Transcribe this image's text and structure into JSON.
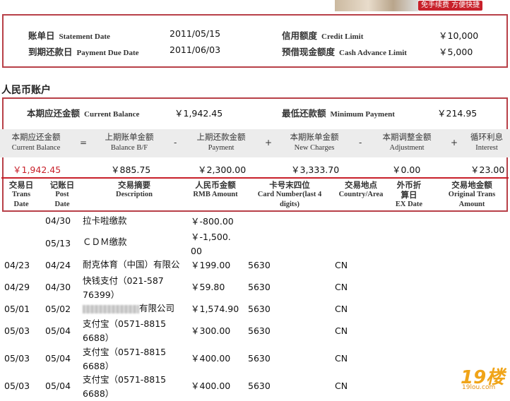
{
  "banner": {
    "text": "免手续费 方便快捷"
  },
  "statement": {
    "statement_date_cn": "账单日",
    "statement_date_en": "Statement Date",
    "statement_date": "2011/05/15",
    "credit_limit_cn": "信用额度",
    "credit_limit_en": "Credit Limit",
    "credit_limit": "￥10,000",
    "due_date_cn": "到期还款日",
    "due_date_en": "Payment Due Date",
    "due_date": "2011/06/03",
    "cash_limit_cn": "预借现金额度",
    "cash_limit_en": "Cash Advance Limit",
    "cash_limit": "￥5,000"
  },
  "rmb": {
    "title": "人民币账户",
    "current_balance_cn": "本期应还金额",
    "current_balance_en": "Current Balance",
    "current_balance": "￥1,942.45",
    "min_payment_cn": "最低还款额",
    "min_payment_en": "Minimum Payment",
    "min_payment": "￥214.95",
    "calc": [
      {
        "cn": "本期应还金额",
        "en": "Current Balance"
      },
      {
        "cn": "上期账单金额",
        "en": "Balance B/F"
      },
      {
        "cn": "上期还款金额",
        "en": "Payment"
      },
      {
        "cn": "本期账单金额",
        "en": "New Charges"
      },
      {
        "cn": "本期调整金额",
        "en": "Adjustment"
      },
      {
        "cn": "循环利息",
        "en": "Interest"
      }
    ],
    "ops": [
      "=",
      "-",
      "+",
      "-",
      "+"
    ],
    "amounts": [
      "￥1,942.45",
      "￥885.75",
      "￥2,300.00",
      "￥3,333.70",
      "￥0.00",
      "￥23.00"
    ]
  },
  "table": {
    "headers": [
      {
        "cn": "交易日",
        "en": "Trans Date"
      },
      {
        "cn": "记账日",
        "en": "Post Date"
      },
      {
        "cn": "交易摘要",
        "en": "Description"
      },
      {
        "cn": "人民币金额",
        "en": "RMB Amount"
      },
      {
        "cn": "卡号末四位",
        "en": "Card Number(last 4 digits)"
      },
      {
        "cn": "交易地点",
        "en": "Country/Area"
      },
      {
        "cn": "外币折算日",
        "en": "EX Date"
      },
      {
        "cn": "交易地金额",
        "en": "Original Trans Amount"
      }
    ],
    "rows": [
      {
        "trans": "",
        "post": "04/30",
        "desc": "拉卡啦缴款",
        "amount": "￥-800.00",
        "card": "",
        "country": ""
      },
      {
        "trans": "",
        "post": "05/13",
        "desc": "ＣＤＭ缴款",
        "amount": "￥-1,500.00",
        "card": "",
        "country": ""
      },
      {
        "trans": "04/23",
        "post": "04/24",
        "desc": "耐克体育（中国）有限公",
        "amount": "￥199.00",
        "card": "5630",
        "country": "CN"
      },
      {
        "trans": "04/29",
        "post": "04/30",
        "desc": "快钱支付（021-58776399）",
        "amount": "￥59.80",
        "card": "5630",
        "country": "CN"
      },
      {
        "trans": "05/01",
        "post": "05/02",
        "desc": "有限公司",
        "amount": "￥1,574.90",
        "card": "5630",
        "country": "CN"
      },
      {
        "trans": "05/03",
        "post": "05/04",
        "desc": "支付宝（0571-88156688）",
        "amount": "￥300.00",
        "card": "5630",
        "country": "CN"
      },
      {
        "trans": "05/03",
        "post": "05/04",
        "desc": "支付宝（0571-88156688）",
        "amount": "￥400.00",
        "card": "5630",
        "country": "CN"
      },
      {
        "trans": "05/03",
        "post": "05/04",
        "desc": "支付宝（0571-88156688）",
        "amount": "￥400.00",
        "card": "5630",
        "country": "CN"
      }
    ]
  },
  "watermark": {
    "big": "19楼",
    "small": "19lou.com"
  }
}
